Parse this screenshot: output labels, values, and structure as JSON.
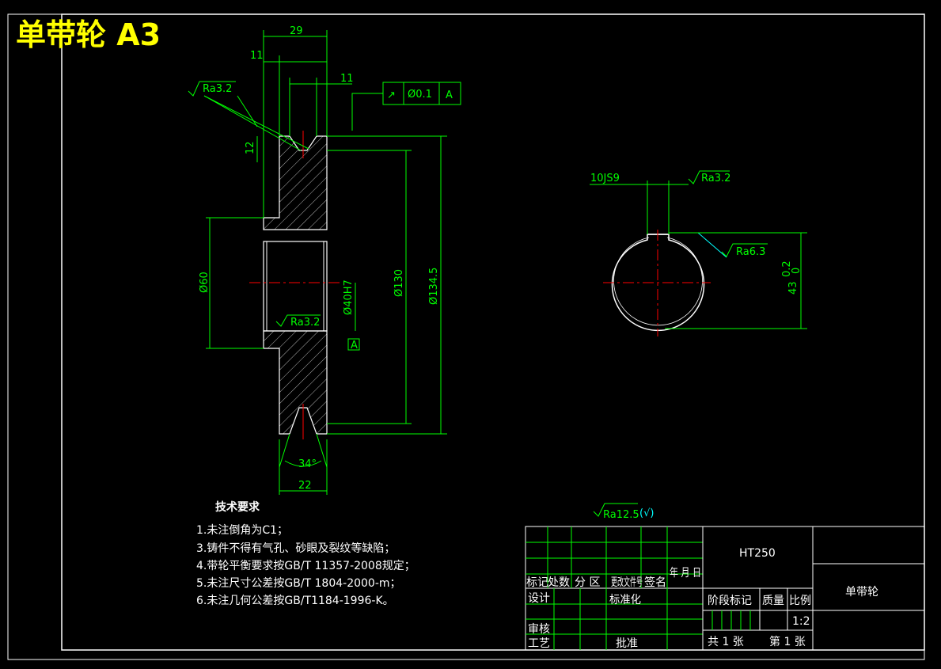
{
  "drawing": {
    "title_banner": "单带轮 A3"
  },
  "dims": {
    "d29": "29",
    "d11a": "11",
    "d11b": "11",
    "d12": "12",
    "d60": "Ø60",
    "d40": "Ø40H7",
    "d130": "Ø130",
    "d134": "Ø134.5",
    "d34": "34°",
    "d22": "22",
    "keyway": "10JS9",
    "d43": "43",
    "tol_up": "0.2",
    "tol_low": "0"
  },
  "roughness": {
    "r1": "Ra3.2",
    "r2": "Ra3.2",
    "r3": "Ra3.2",
    "r4": "Ra6.3",
    "general": "Ra12.5",
    "general_suffix": "(√)"
  },
  "tolerance_frame": {
    "symbol": "↗",
    "value": "Ø0.1",
    "datum": "A"
  },
  "datum_label": "A",
  "tech_req": {
    "heading": "技术要求",
    "items": [
      "1.未注倒角为C1；",
      "3.铸件不得有气孔、砂眼及裂纹等缺陷；",
      "4.带轮平衡要求按GB/T 11357-2008规定；",
      "5.未注尺寸公差按GB/T 1804-2000-m；",
      "6.未注几何公差按GB/T1184-1996-K。"
    ]
  },
  "titleblock": {
    "material": "HT250",
    "part_name": "单带轮",
    "biaoji": "标记",
    "chushu": "处数",
    "fenqu": "分 区",
    "gengaiwenjian": "更改文件号",
    "qianming": "签名",
    "nianyueri": "年 月 日",
    "sheji": "设计",
    "biaozhunhua": "标准化",
    "shenhe": "审核",
    "gongyi": "工艺",
    "pizhun": "批准",
    "jieduan": "阶段标记",
    "zhiliang": "质量",
    "bili": "比例",
    "scale": "1:2",
    "gong": "共 1 张",
    "di": "第 1 张"
  }
}
